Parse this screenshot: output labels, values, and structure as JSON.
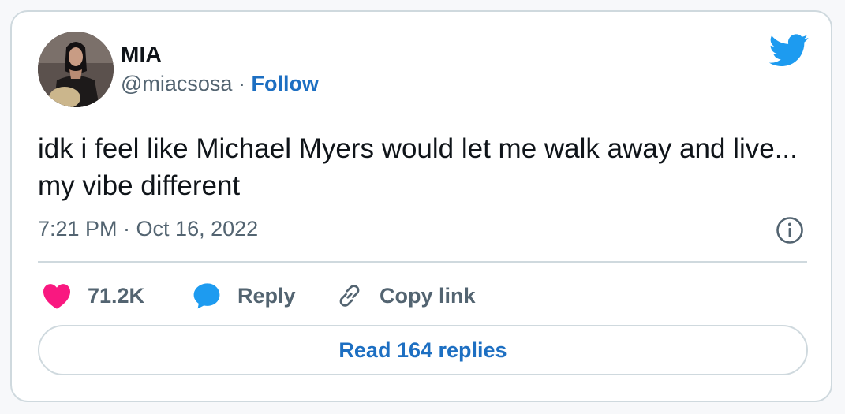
{
  "author": {
    "name": "MIA",
    "handle": "@miacsosa",
    "separator": " · ",
    "follow_label": "Follow"
  },
  "tweet": {
    "text": "idk i feel like Michael Myers would let me walk away and live... my vibe different",
    "timestamp": "7:21 PM · Oct 16, 2022"
  },
  "actions": {
    "like_count": "71.2K",
    "reply_label": "Reply",
    "copy_link_label": "Copy link"
  },
  "read_replies_label": "Read 164 replies",
  "icons": {
    "brand": "twitter-bird-icon",
    "info": "info-icon",
    "like": "heart-icon",
    "reply": "speech-bubble-icon",
    "copy": "link-icon"
  },
  "colors": {
    "accent_blue": "#1d6fc2",
    "bird_blue": "#1d9bf0",
    "heart_pink": "#f91880",
    "text_primary": "#0f1419",
    "text_secondary": "#536471",
    "border": "#cfd9de"
  }
}
